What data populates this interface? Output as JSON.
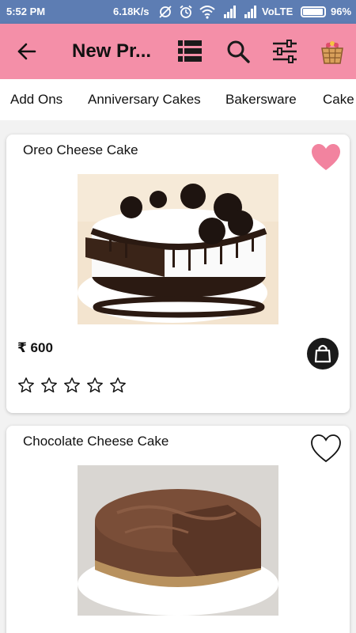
{
  "status_bar": {
    "time": "5:52 PM",
    "speed": "6.18K/s",
    "network": "VoLTE",
    "battery_percent_label": "96%",
    "battery_level": 0.96
  },
  "app_bar": {
    "title": "New Pr...",
    "icons": [
      "back-arrow-icon",
      "list-view-icon",
      "search-icon",
      "filter-sliders-icon",
      "basket-cart-icon"
    ]
  },
  "categories": [
    "Add Ons",
    "Anniversary Cakes",
    "Bakersware",
    "Cake"
  ],
  "products": [
    {
      "name": "Oreo Cheese Cake",
      "price": "₹ 600",
      "favorite": true,
      "rating": 0,
      "max_rating": 5
    },
    {
      "name": "Chocolate Cheese Cake",
      "favorite": false
    }
  ],
  "colors": {
    "status_bar": "#5d7db3",
    "app_bar": "#f48fa8",
    "favorite_heart": "#f2839f",
    "bag_button": "#1a1a1a"
  }
}
